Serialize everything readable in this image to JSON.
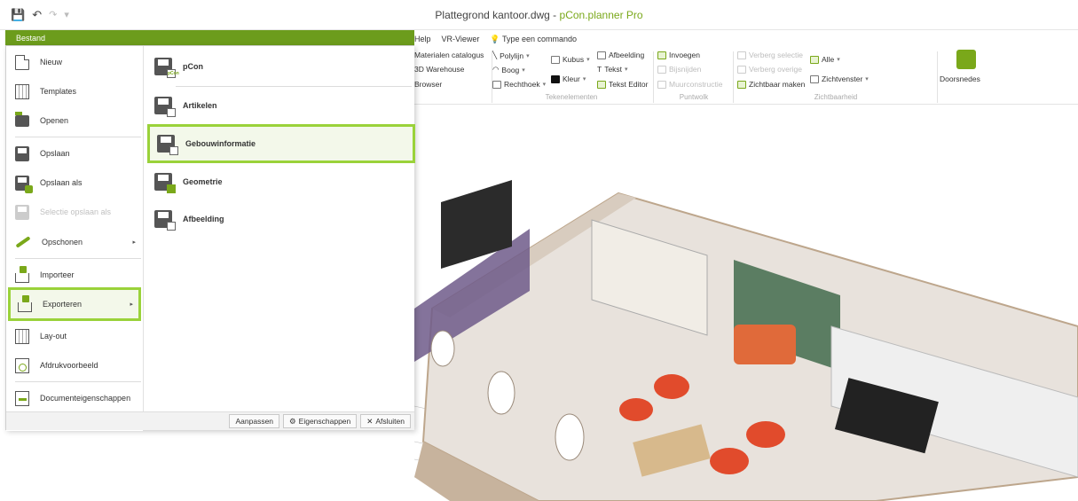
{
  "quick_access": {
    "save_icon": "save-icon",
    "undo_icon": "undo-icon",
    "redo_icon": "redo-icon",
    "dropdown_icon": "chevron-down-icon"
  },
  "window": {
    "title_file": "Plattegrond kantoor.dwg - ",
    "title_app": "pCon.planner Pro"
  },
  "ribbon": {
    "tabs": [
      "Help",
      "VR-Viewer",
      "Type een commando"
    ],
    "col0": [
      "Materialen catalogus",
      "3D Warehouse",
      "Browser"
    ],
    "tekenelementen": {
      "title": "Tekenelementen",
      "items": [
        "Polylijn",
        "Boog",
        "Rechthoek",
        "Kubus",
        "Kleur",
        "Afbeelding",
        "Tekst",
        "Tekst Editor"
      ]
    },
    "puntwolk": {
      "title": "Puntwolk",
      "items": [
        "Invoegen",
        "Bijsnijden",
        "Muurconstructie"
      ]
    },
    "zichtbaarheid": {
      "title": "Zichtbaarheid",
      "items": [
        "Verberg selectie",
        "Verberg overige",
        "Zichtbaar maken",
        "Alle",
        "Zichtvenster",
        "Doorsnedes"
      ]
    }
  },
  "menu": {
    "header": "Bestand",
    "items": [
      {
        "label": "Nieuw",
        "icon": "new-document-icon"
      },
      {
        "label": "Templates",
        "icon": "templates-icon"
      },
      {
        "label": "Openen",
        "icon": "open-folder-icon"
      },
      {
        "label": "Opslaan",
        "icon": "save-icon"
      },
      {
        "label": "Opslaan als",
        "icon": "save-as-icon"
      },
      {
        "label": "Selectie opslaan als",
        "icon": "save-selection-icon"
      },
      {
        "label": "Opschonen",
        "icon": "broom-icon"
      },
      {
        "label": "Importeer",
        "icon": "import-icon"
      },
      {
        "label": "Exporteren",
        "icon": "export-icon"
      },
      {
        "label": "Lay-out",
        "icon": "layout-icon"
      },
      {
        "label": "Afdrukvoorbeeld",
        "icon": "print-preview-icon"
      },
      {
        "label": "Documenteigenschappen",
        "icon": "document-properties-icon"
      }
    ],
    "submenu": [
      {
        "label": "pCon",
        "badge": "pCon"
      },
      {
        "label": "Artikelen"
      },
      {
        "label": "Gebouwinformatie"
      },
      {
        "label": "Geometrie"
      },
      {
        "label": "Afbeelding"
      }
    ],
    "footer": {
      "customize": "Aanpassen",
      "properties": "Eigenschappen",
      "close": "Afsluiten"
    }
  }
}
